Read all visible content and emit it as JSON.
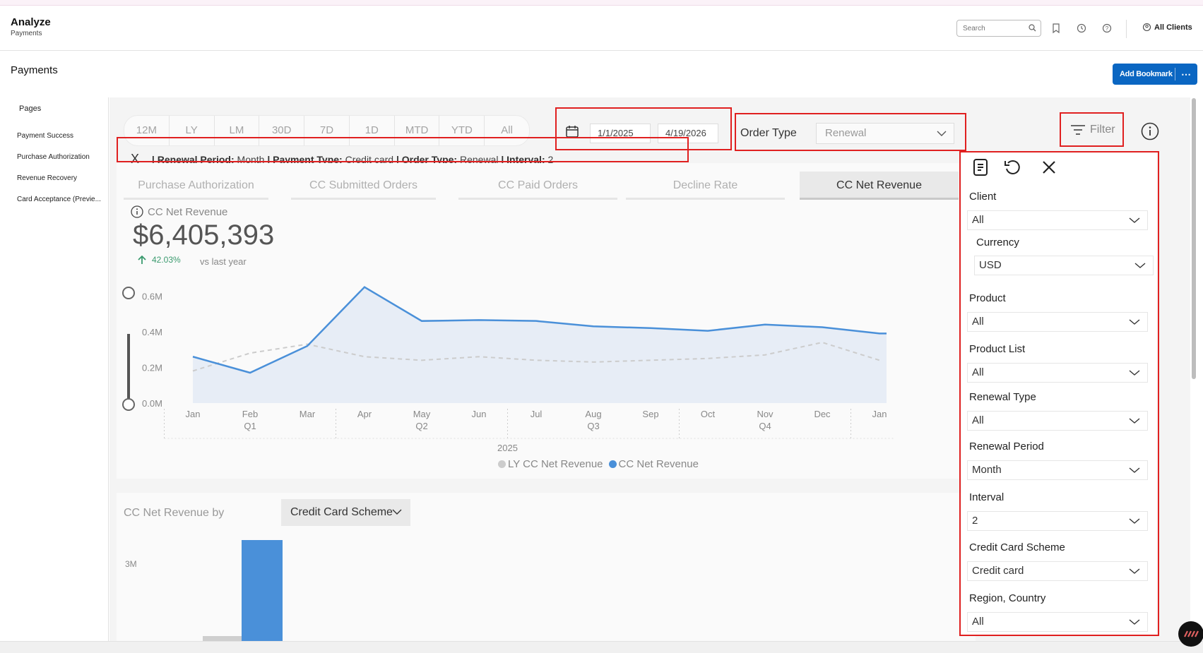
{
  "header": {
    "title": "Analyze",
    "subtitle": "Payments",
    "search_placeholder": "Search",
    "icons": [
      "bookmark-icon",
      "history-icon",
      "help-icon"
    ],
    "all_clients": "All Clients"
  },
  "page": {
    "title": "Payments",
    "add_bookmark": "Add Bookmark",
    "more": "⋯"
  },
  "sidebar": {
    "title": "Pages",
    "items": [
      "Payment Success",
      "Purchase Authorization",
      "Revenue Recovery",
      "Card Acceptance (Previe..."
    ]
  },
  "quick_ranges": [
    "12M",
    "LY",
    "LM",
    "30D",
    "7D",
    "1D",
    "MTD",
    "YTD",
    "All"
  ],
  "date_range": {
    "start": "1/1/2025",
    "end": "4/19/2026"
  },
  "order_type": {
    "label": "Order Type",
    "value": "Renewal"
  },
  "filter_button": "Filter",
  "filter_chips": {
    "clear": "X",
    "renewal_period_key": "| Renewal Period:",
    "renewal_period_val": "Month",
    "payment_type_key": "| Payment Type:",
    "payment_type_val": "Credit card",
    "order_type_key": "| Order Type:",
    "order_type_val": "Renewal",
    "interval_key": "| Interval:",
    "interval_val": "2"
  },
  "tabs": [
    "Purchase Authorization",
    "CC Submitted Orders",
    "CC Paid Orders",
    "Decline Rate",
    "CC Net Revenue"
  ],
  "active_tab": "CC Net Revenue",
  "kpi": {
    "label": "CC Net Revenue",
    "value": "$6,405,393",
    "delta": "42.03%",
    "vs": "vs last year"
  },
  "chart_data": {
    "type": "line",
    "title": "",
    "xlabel": "2025",
    "ylabel": "",
    "categories": [
      "Jan",
      "Feb",
      "Mar",
      "Apr",
      "May",
      "Jun",
      "Jul",
      "Aug",
      "Sep",
      "Oct",
      "Nov",
      "Dec",
      "Jan"
    ],
    "quarter_labels": [
      "",
      "Q1",
      "",
      "",
      "Q2",
      "",
      "",
      "Q3",
      "",
      "",
      "Q4",
      "",
      ""
    ],
    "yticks": [
      "0.0M",
      "0.2M",
      "0.4M",
      "0.6M"
    ],
    "ylim": [
      0,
      0.7
    ],
    "series": [
      {
        "name": "LY CC Net Revenue",
        "color": "#cccccc",
        "style": "dashed",
        "values": [
          0.18,
          0.28,
          0.33,
          0.26,
          0.24,
          0.26,
          0.24,
          0.23,
          0.24,
          0.25,
          0.27,
          0.34,
          0.24
        ]
      },
      {
        "name": "CC Net Revenue",
        "color": "#4a90d9",
        "style": "solid",
        "fill": "#e7edf6",
        "values": [
          0.26,
          0.17,
          0.32,
          0.65,
          0.46,
          0.465,
          0.46,
          0.43,
          0.42,
          0.405,
          0.44,
          0.425,
          0.39
        ]
      }
    ],
    "grid": false,
    "legend": "bottom"
  },
  "breakdown": {
    "title": "CC Net Revenue by",
    "dimension": "Credit Card Scheme",
    "ytick": "3M"
  },
  "filter_panel": {
    "icons": [
      "report-icon",
      "reset-icon",
      "close-icon"
    ],
    "fields": [
      {
        "label": "Client",
        "value": "All"
      },
      {
        "label": "Currency",
        "value": "USD"
      },
      {
        "label": "Product",
        "value": "All"
      },
      {
        "label": "Product List",
        "value": "All"
      },
      {
        "label": "Renewal Type",
        "value": "All"
      },
      {
        "label": "Renewal Period",
        "value": "Month"
      },
      {
        "label": "Interval",
        "value": "2"
      },
      {
        "label": "Credit Card Scheme",
        "value": "Credit card"
      },
      {
        "label": "Region, Country",
        "value": "All"
      }
    ]
  },
  "colors": {
    "accent": "#0a66c2",
    "highlight": "#e02020",
    "positive": "#3a9a6e",
    "series_blue": "#4a90d9"
  }
}
